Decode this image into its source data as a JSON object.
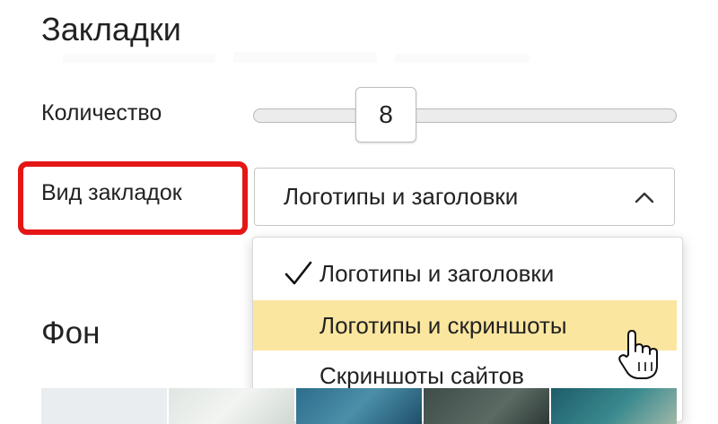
{
  "bookmarks": {
    "title": "Закладки",
    "count_label": "Количество",
    "count_value": "8",
    "view_label": "Вид закладок",
    "view_selected": "Логотипы и заголовки"
  },
  "dropdown": {
    "options": [
      {
        "label": "Логотипы и заголовки",
        "checked": true
      },
      {
        "label": "Логотипы и скриншоты",
        "hovered": true
      },
      {
        "label": "Скриншоты сайтов"
      }
    ]
  },
  "background": {
    "title": "Фон"
  },
  "colors": {
    "highlight_outline": "#e51616",
    "hover_option": "#fbe69f"
  },
  "icons": {
    "select_chevron": "chevron-up-icon",
    "checked_option": "check-icon",
    "pointer": "hand-pointer-icon"
  }
}
